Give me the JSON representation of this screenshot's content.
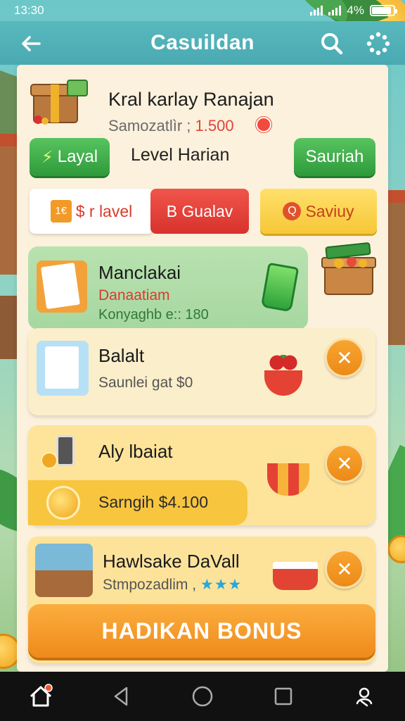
{
  "status_bar": {
    "time": "13:30",
    "battery_text": "4%",
    "battery_level": 0.9
  },
  "app_bar": {
    "title": "Casuildan",
    "back_icon": "arrow-left-icon",
    "search_icon": "search-icon",
    "menu_icon": "dots-loader-icon"
  },
  "header": {
    "player_name": "Kral karlay Ranajan",
    "subtitle_label": "Samozatlìr ;",
    "subtitle_amount": "1.500"
  },
  "actions": {
    "layal_label": "Layal",
    "level_label": "Level Harian",
    "sauriah_label": "Sauriah"
  },
  "tabs": {
    "level_tag": "1€",
    "level_label": "$ r lavel",
    "gualav_label": "B Gualav",
    "saviuy_label": "Saviuy"
  },
  "cards": [
    {
      "title": "Manclakai",
      "subtitle": "Danaatiam",
      "detail": "Konyaghb e:: 180"
    },
    {
      "title": "Balalt",
      "subtitle": "Saunlei gat $0"
    },
    {
      "title": "Aly lbaiat",
      "coin_text": "Sarngih $4.100"
    },
    {
      "title": "Hawlsake DaVall",
      "subtitle": "Stmpozadlim ,",
      "stars": "★★★",
      "bonus_label": "HADIKAN BONUS"
    }
  ],
  "colors": {
    "accent_teal": "#4aa9b2",
    "accent_orange": "#ef8a1c",
    "accent_green": "#2e9a3a",
    "accent_red": "#d8322d",
    "panel": "#fbf1dc"
  }
}
